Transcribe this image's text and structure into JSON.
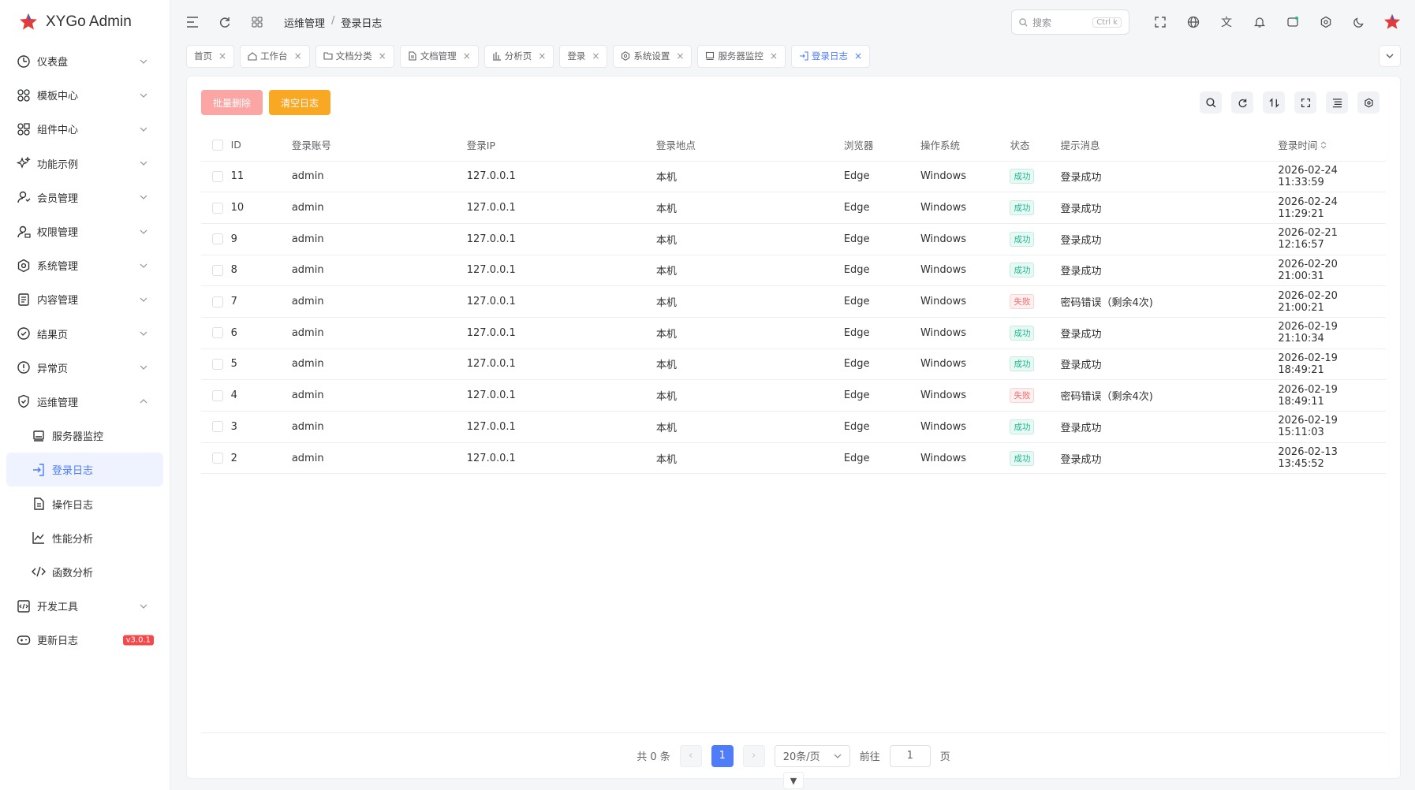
{
  "app": {
    "title": "XYGo Admin"
  },
  "sidebar": {
    "items": [
      {
        "label": "仪表盘",
        "icon": "dashboard-icon"
      },
      {
        "label": "模板中心",
        "icon": "grid-icon"
      },
      {
        "label": "组件中心",
        "icon": "component-icon"
      },
      {
        "label": "功能示例",
        "icon": "sparkle-icon"
      },
      {
        "label": "会员管理",
        "icon": "user-icon"
      },
      {
        "label": "权限管理",
        "icon": "user-lock-icon"
      },
      {
        "label": "系统管理",
        "icon": "gear-icon"
      },
      {
        "label": "内容管理",
        "icon": "document-icon"
      },
      {
        "label": "结果页",
        "icon": "check-circle-icon"
      },
      {
        "label": "异常页",
        "icon": "warning-circle-icon"
      },
      {
        "label": "运维管理",
        "icon": "shield-icon"
      },
      {
        "label": "服务器监控",
        "icon": "server-icon"
      },
      {
        "label": "登录日志",
        "icon": "login-icon"
      },
      {
        "label": "操作日志",
        "icon": "file-text-icon"
      },
      {
        "label": "性能分析",
        "icon": "line-chart-icon"
      },
      {
        "label": "函数分析",
        "icon": "code-icon"
      },
      {
        "label": "开发工具",
        "icon": "dev-tools-icon"
      },
      {
        "label": "更新日志",
        "icon": "update-icon",
        "badge": "v3.0.1"
      }
    ]
  },
  "breadcrumb": {
    "parent": "运维管理",
    "sep": "/",
    "current": "登录日志"
  },
  "search": {
    "placeholder": "搜索",
    "shortcut": "Ctrl k"
  },
  "tabs": [
    {
      "label": "首页"
    },
    {
      "label": "工作台"
    },
    {
      "label": "文档分类"
    },
    {
      "label": "文档管理"
    },
    {
      "label": "分析页"
    },
    {
      "label": "登录"
    },
    {
      "label": "系统设置"
    },
    {
      "label": "服务器监控"
    },
    {
      "label": "登录日志"
    }
  ],
  "toolbar": {
    "batch_delete": "批量删除",
    "clear_log": "清空日志"
  },
  "table": {
    "headers": [
      "ID",
      "登录账号",
      "登录IP",
      "登录地点",
      "浏览器",
      "操作系统",
      "状态",
      "提示消息",
      "登录时间"
    ],
    "rows": [
      {
        "id": "11",
        "account": "admin",
        "ip": "127.0.0.1",
        "location": "本机",
        "browser": "Edge",
        "os": "Windows",
        "status": "成功",
        "msg": "登录成功",
        "time": "2026-02-24 11:33:59"
      },
      {
        "id": "10",
        "account": "admin",
        "ip": "127.0.0.1",
        "location": "本机",
        "browser": "Edge",
        "os": "Windows",
        "status": "成功",
        "msg": "登录成功",
        "time": "2026-02-24 11:29:21"
      },
      {
        "id": "9",
        "account": "admin",
        "ip": "127.0.0.1",
        "location": "本机",
        "browser": "Edge",
        "os": "Windows",
        "status": "成功",
        "msg": "登录成功",
        "time": "2026-02-21 12:16:57"
      },
      {
        "id": "8",
        "account": "admin",
        "ip": "127.0.0.1",
        "location": "本机",
        "browser": "Edge",
        "os": "Windows",
        "status": "成功",
        "msg": "登录成功",
        "time": "2026-02-20 21:00:31"
      },
      {
        "id": "7",
        "account": "admin",
        "ip": "127.0.0.1",
        "location": "本机",
        "browser": "Edge",
        "os": "Windows",
        "status": "失败",
        "msg": "密码错误（剩余4次)",
        "time": "2026-02-20 21:00:21"
      },
      {
        "id": "6",
        "account": "admin",
        "ip": "127.0.0.1",
        "location": "本机",
        "browser": "Edge",
        "os": "Windows",
        "status": "成功",
        "msg": "登录成功",
        "time": "2026-02-19 21:10:34"
      },
      {
        "id": "5",
        "account": "admin",
        "ip": "127.0.0.1",
        "location": "本机",
        "browser": "Edge",
        "os": "Windows",
        "status": "成功",
        "msg": "登录成功",
        "time": "2026-02-19 18:49:21"
      },
      {
        "id": "4",
        "account": "admin",
        "ip": "127.0.0.1",
        "location": "本机",
        "browser": "Edge",
        "os": "Windows",
        "status": "失败",
        "msg": "密码错误（剩余4次)",
        "time": "2026-02-19 18:49:11"
      },
      {
        "id": "3",
        "account": "admin",
        "ip": "127.0.0.1",
        "location": "本机",
        "browser": "Edge",
        "os": "Windows",
        "status": "成功",
        "msg": "登录成功",
        "time": "2026-02-19 15:11:03"
      },
      {
        "id": "2",
        "account": "admin",
        "ip": "127.0.0.1",
        "location": "本机",
        "browser": "Edge",
        "os": "Windows",
        "status": "成功",
        "msg": "登录成功",
        "time": "2026-02-13 13:45:52"
      }
    ]
  },
  "pager": {
    "total": "共 0 条",
    "page": "1",
    "size": "20条/页",
    "goto_label": "前往",
    "goto_value": "1",
    "page_unit": "页"
  },
  "colors": {
    "accent": "#4f7df9",
    "success": "#20b894",
    "danger": "#f56c6c",
    "warning": "#f9a823"
  }
}
